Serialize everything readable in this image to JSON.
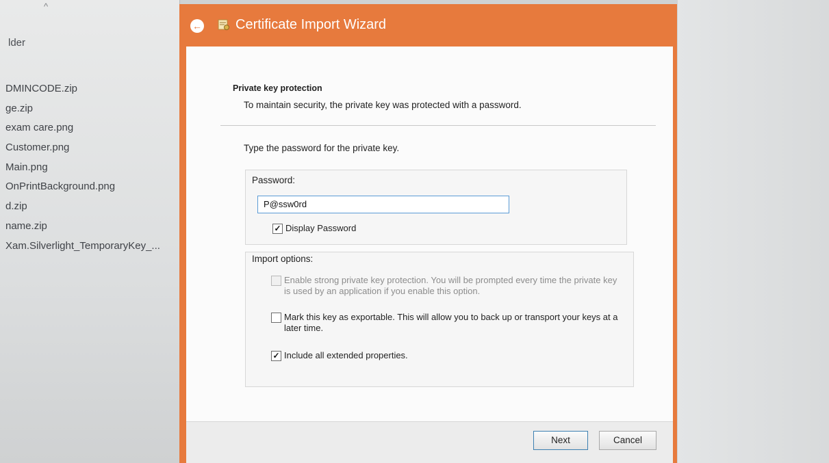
{
  "explorer": {
    "folder_label": "lder",
    "files": [
      "DMINCODE.zip",
      "ge.zip",
      "exam care.png",
      "Customer.png",
      "Main.png",
      "OnPrintBackground.png",
      "d.zip",
      "name.zip",
      "Xam.Silverlight_TemporaryKey_..."
    ]
  },
  "wizard": {
    "title": "Certificate Import Wizard",
    "section_title": "Private key protection",
    "section_subtitle": "To maintain security, the private key was protected with a password.",
    "instruction": "Type the password for the private key.",
    "password_label": "Password:",
    "password_value": "P@ssw0rd",
    "display_password_label": "Display Password",
    "import_options_label": "Import options:",
    "options": {
      "strong_protection": "Enable strong private key protection. You will be prompted every time the private key is used by an application if you enable this option.",
      "exportable": "Mark this key as exportable. This will allow you to back up or transport your keys at a later time.",
      "extended_properties": "Include all extended properties."
    },
    "next_label": "Next",
    "cancel_label": "Cancel"
  },
  "colors": {
    "accent": "#e77a3d",
    "focus_border": "#5a9bd5"
  },
  "icons": {
    "back": "back-arrow-icon",
    "certificate": "certificate-icon",
    "check": "checkmark"
  }
}
